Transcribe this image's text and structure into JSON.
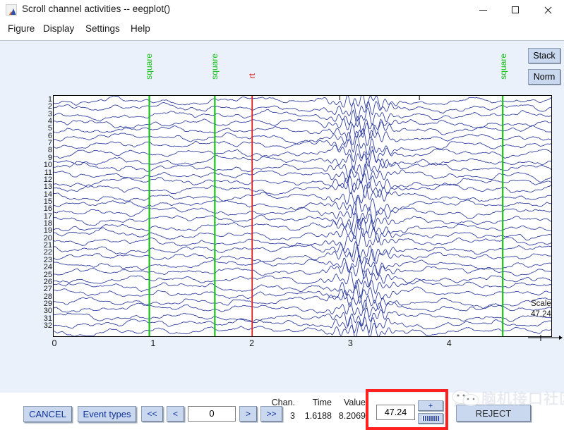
{
  "window": {
    "title": "Scroll channel activities -- eegplot()",
    "app_icon": "matlab-figure-icon",
    "controls": {
      "minimize": "–",
      "maximize": "□",
      "close": "✕"
    }
  },
  "menu": {
    "items": [
      {
        "label": "Figure",
        "x": 8
      },
      {
        "label": "Display",
        "x": 58
      },
      {
        "label": "Settings",
        "x": 118
      },
      {
        "label": "Help",
        "x": 182
      }
    ]
  },
  "side_buttons": {
    "stack": "Stack",
    "norm": "Norm"
  },
  "plot": {
    "channel_labels": [
      "1",
      "2",
      "3",
      "4",
      "5",
      "6",
      "7",
      "8",
      "9",
      "10",
      "11",
      "12",
      "13",
      "14",
      "15",
      "16",
      "17",
      "18",
      "19",
      "20",
      "21",
      "22",
      "23",
      "24",
      "25",
      "26",
      "27",
      "28",
      "29",
      "30",
      "31",
      "32"
    ],
    "x_ticks": [
      "0",
      "1",
      "2",
      "3",
      "4"
    ],
    "trace_color": "#2b3a9e",
    "background": "#ffffff",
    "events": [
      {
        "label": "square",
        "type": "green",
        "x_frac": 0.1923
      },
      {
        "label": "square",
        "type": "green",
        "x_frac": 0.3239
      },
      {
        "label": "rt",
        "type": "red",
        "x_frac": 0.3989
      },
      {
        "label": "square",
        "type": "green",
        "x_frac": 0.9024
      }
    ],
    "event_colors": {
      "green": "#17c217",
      "red": "#e02020"
    }
  },
  "scale_legend": {
    "label": "Scale",
    "value": "47.24"
  },
  "controls": {
    "cancel": "CANCEL",
    "event_types": "Event types",
    "first": "<<",
    "prev": "<",
    "next": ">",
    "last": ">>",
    "position_value": "0"
  },
  "readout": {
    "headers": [
      "Chan.",
      "Time",
      "Value"
    ],
    "values": [
      "3",
      "1.6188",
      "8.2069"
    ]
  },
  "scale_spinner": {
    "value": "47.24",
    "increase": "+",
    "decrease": "-",
    "highlight_color": "#ff2020"
  },
  "reject_button": {
    "label": "REJECT"
  },
  "watermark": {
    "text": "脑机接口社区"
  }
}
